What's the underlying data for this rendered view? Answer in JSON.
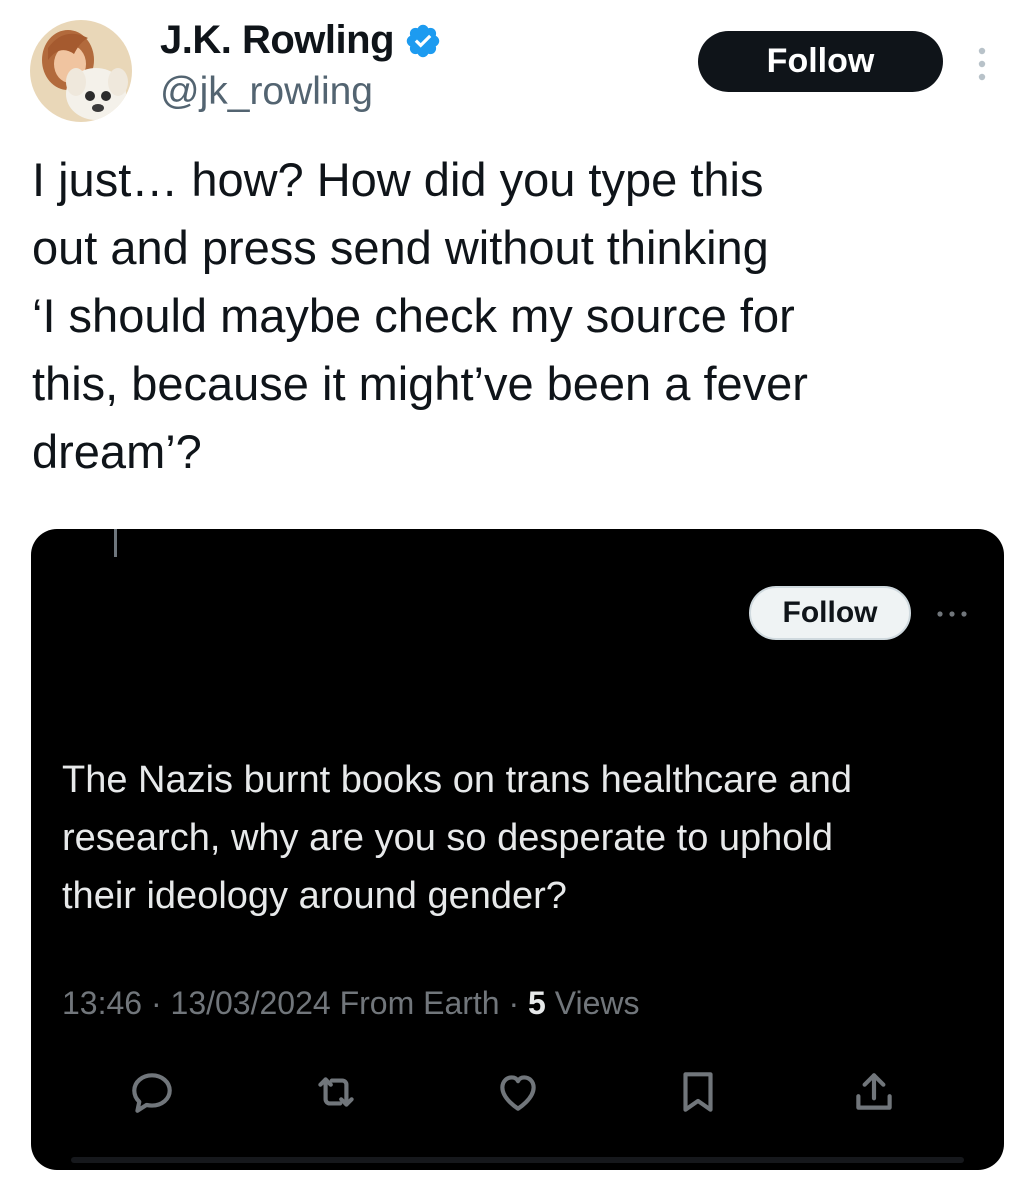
{
  "author": {
    "display_name": "J.K. Rowling",
    "handle": "@jk_rowling",
    "verified": true,
    "avatar": "avatar-photo"
  },
  "header": {
    "follow_label": "Follow",
    "more_icon": "more-vertical-icon"
  },
  "tweet": {
    "text": "I just… how? How did you type this\nout and press send without thinking\n‘I should maybe check my source for\nthis, because it might’ve been a fever\ndream’?"
  },
  "quoted": {
    "follow_label": "Follow",
    "more_icon": "more-horizontal-icon",
    "text": "The Nazis burnt books on trans healthcare and\nresearch, why are you so desperate to uphold\ntheir ideology around gender?",
    "time": "13:46",
    "date": "13/03/2024",
    "source": "From Earth",
    "views_count": "5",
    "views_label": "Views",
    "actions": [
      "reply-icon",
      "retweet-icon",
      "like-icon",
      "bookmark-icon",
      "share-icon"
    ]
  },
  "colors": {
    "verified_blue": "#1d9bf0",
    "text_primary": "#0f1419",
    "text_secondary": "#536471",
    "embed_bg": "#000000",
    "embed_muted": "#71767b"
  }
}
